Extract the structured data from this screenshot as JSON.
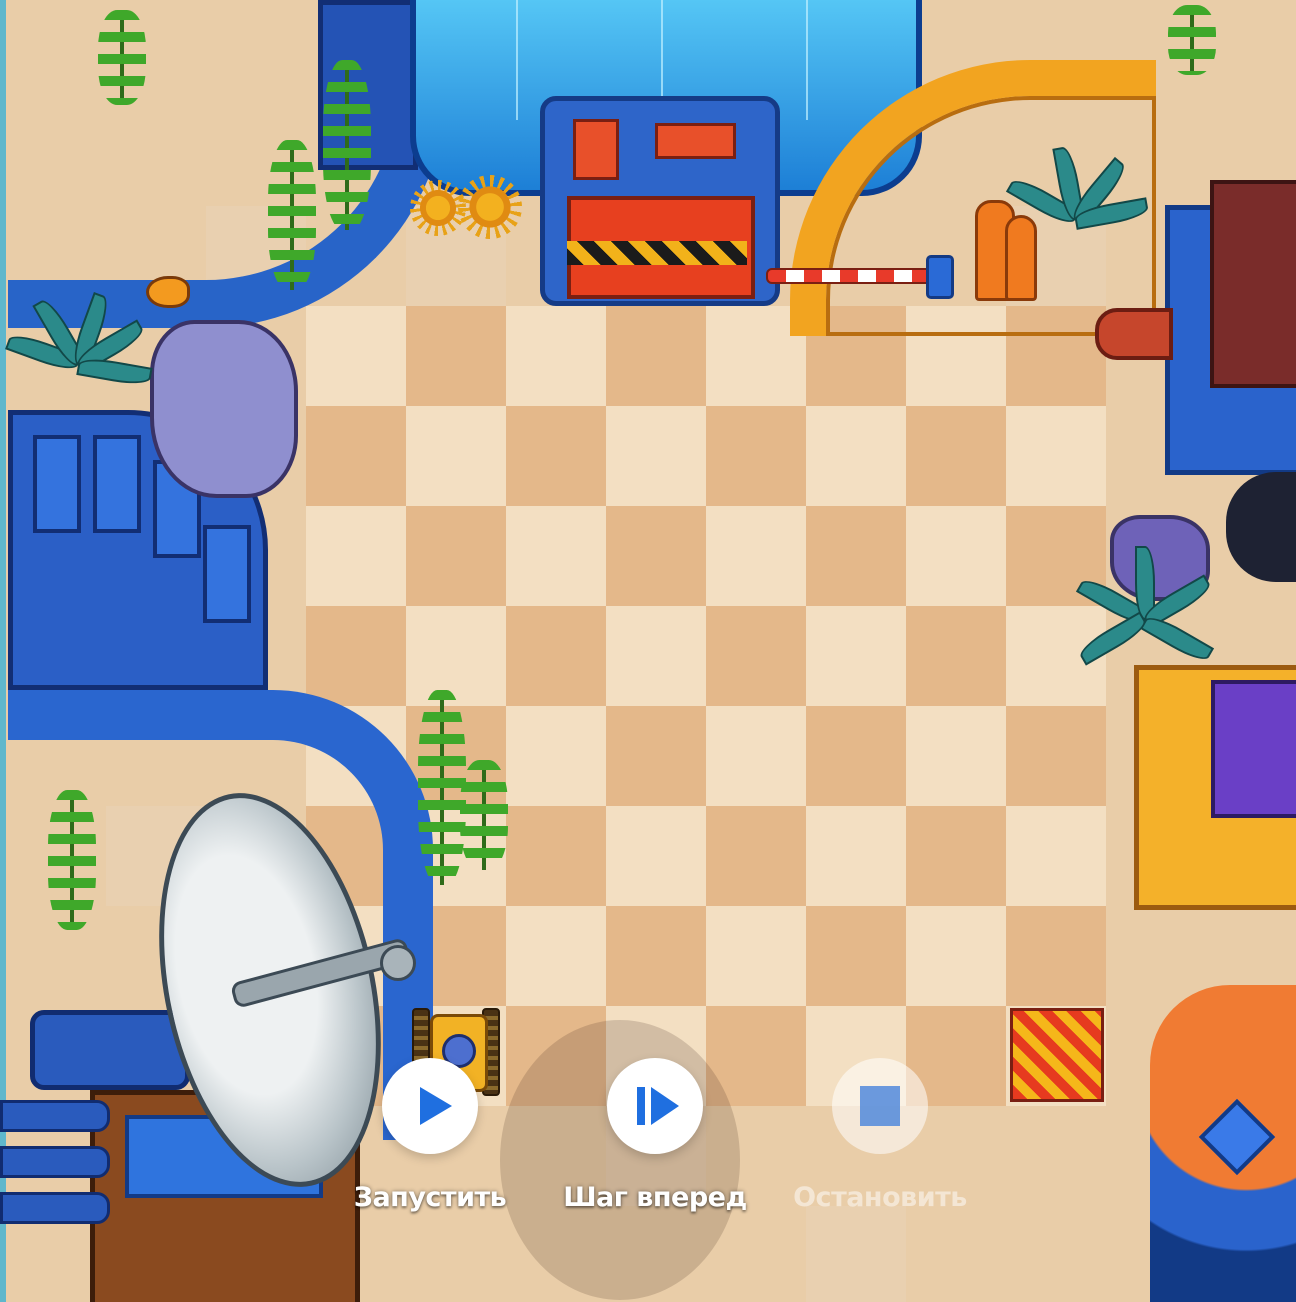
{
  "scene": {
    "board": {
      "rows": 8,
      "cols": 8,
      "light_color": "#f3dfc2",
      "dark_color": "#e4b88a"
    },
    "robot": {
      "icon": "tank-robot-icon",
      "color": "#f2b225"
    },
    "target": {
      "icon": "striped-target-tile-icon",
      "colors": [
        "#e63a1f",
        "#f5b71a"
      ]
    }
  },
  "controls": {
    "run": {
      "label": "Запустить",
      "icon": "play-icon",
      "enabled": true
    },
    "step": {
      "label": "Шаг вперед",
      "icon": "step-forward-icon",
      "enabled": true
    },
    "stop": {
      "label": "Остановить",
      "icon": "stop-icon",
      "enabled": false
    }
  },
  "colors": {
    "accent": "#1f6fe0",
    "water_edge": "#5fb7cc"
  }
}
